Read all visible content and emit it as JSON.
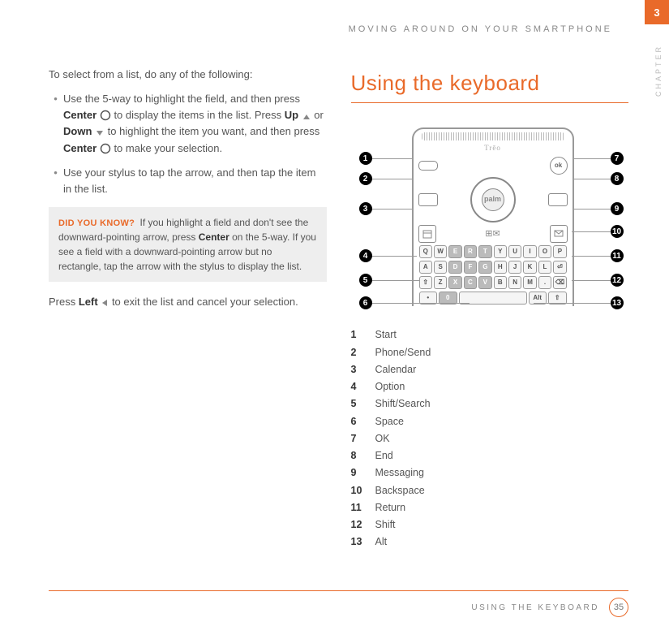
{
  "header": {
    "running_title": "MOVING AROUND ON YOUR SMARTPHONE",
    "chapter_number": "3",
    "side_label": "CHAPTER"
  },
  "left_col": {
    "intro": "To select from a list, do any of the following:",
    "bullet1": {
      "pre1": "Use the 5-way to highlight the field, and then press ",
      "b1": "Center",
      "post1": " to display the items in the list. Press ",
      "b2": "Up",
      "mid": " or ",
      "b3": "Down",
      "post2": " to highlight the item you want, and then press ",
      "b4": "Center",
      "post3": " to make your selection."
    },
    "bullet2": "Use your stylus to tap the arrow, and then tap the item in the list.",
    "tip": {
      "label": "DID YOU KNOW?",
      "t1": "If you highlight a field and don't see the downward-pointing arrow, press ",
      "b1": "Center",
      "t2": " on the 5-way. If you see a field with a downward-pointing arrow but no rectangle, tap the arrow with the stylus to display the list."
    },
    "outro_pre": "Press ",
    "outro_b": "Left",
    "outro_post": " to exit the list and cancel your selection."
  },
  "right_col": {
    "title": "Using the keyboard"
  },
  "diagram": {
    "brand": "Trēo",
    "dpad_label": "palm",
    "ok_label": "ok",
    "rows": {
      "r1": [
        "Q",
        "W",
        "E",
        "R",
        "T",
        "Y",
        "U",
        "I",
        "O",
        "P"
      ],
      "r2": [
        "A",
        "S",
        "D",
        "F",
        "G",
        "H",
        "J",
        "K",
        "L",
        "⏎"
      ],
      "r3": [
        "⇧",
        "Z",
        "X",
        "C",
        "V",
        "B",
        "N",
        "M",
        ".",
        "⌫"
      ],
      "r4_left": "•",
      "r4_mid1": "0",
      "r4_alt": "Alt",
      "r4_right": "⇧"
    }
  },
  "legend": {
    "items": [
      {
        "n": "1",
        "label": "Start"
      },
      {
        "n": "2",
        "label": "Phone/Send"
      },
      {
        "n": "3",
        "label": "Calendar"
      },
      {
        "n": "4",
        "label": "Option"
      },
      {
        "n": "5",
        "label": "Shift/Search"
      },
      {
        "n": "6",
        "label": "Space"
      },
      {
        "n": "7",
        "label": "OK"
      },
      {
        "n": "8",
        "label": "End"
      },
      {
        "n": "9",
        "label": "Messaging"
      },
      {
        "n": "10",
        "label": "Backspace"
      },
      {
        "n": "11",
        "label": "Return"
      },
      {
        "n": "12",
        "label": "Shift"
      },
      {
        "n": "13",
        "label": "Alt"
      }
    ]
  },
  "footer": {
    "section_title": "USING THE KEYBOARD",
    "page": "35"
  }
}
